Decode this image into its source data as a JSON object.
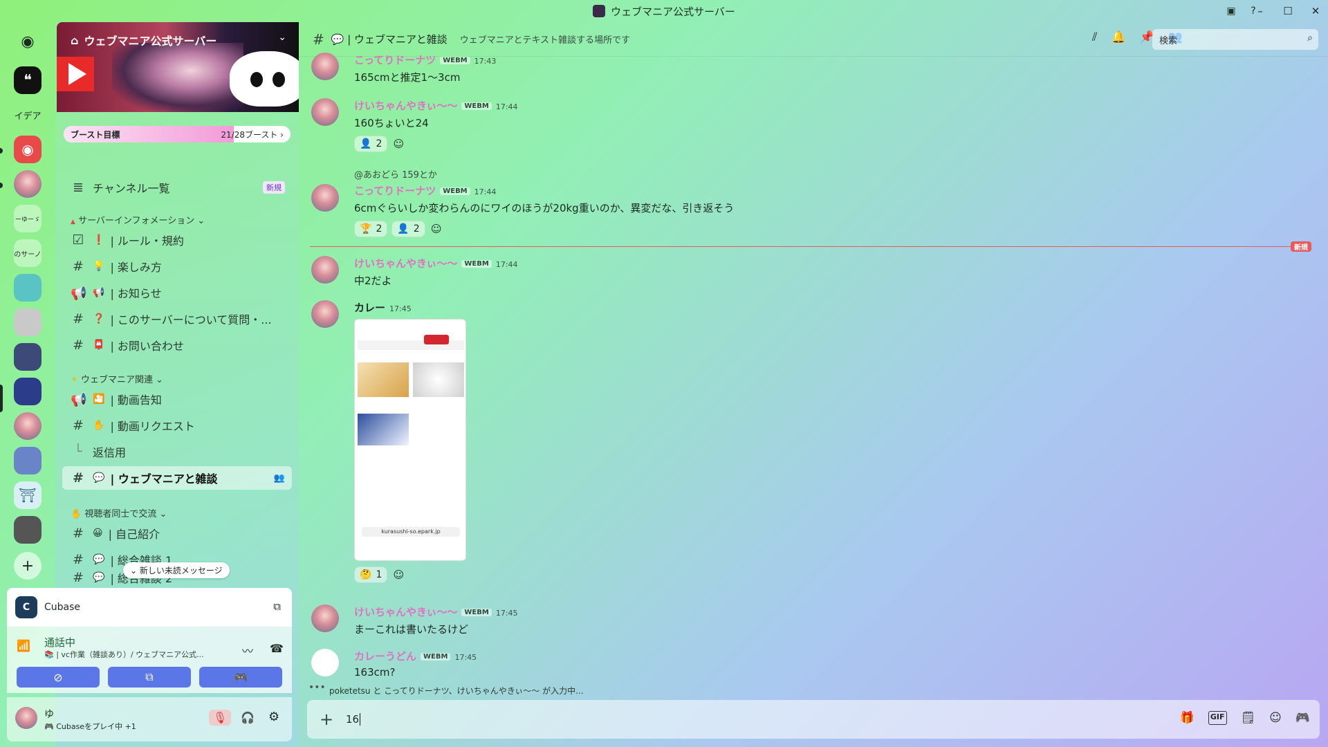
{
  "window": {
    "title": "ウェブマニア公式サーバー",
    "minimize": "–",
    "maximize": "☐",
    "close": "✕",
    "inbox_icon": "▣",
    "help_icon": "?"
  },
  "rail": {
    "labels": {
      "idea": "イデア",
      "other1": "ーゆーゞ",
      "other2": "のサーノ"
    },
    "add": "+"
  },
  "server": {
    "name": "ウェブマニア公式サーバー",
    "chevron": "⌄",
    "boost": {
      "label": "ブースト目標",
      "count": "21/28ブースト ›",
      "progress": 0.75
    },
    "channel_list": "チャンネル一覧",
    "new_badge": "新規",
    "categories": [
      {
        "name": "サーバーインフォメーション ⌄",
        "emoji": "▲"
      },
      {
        "name": "ウェブマニア関連 ⌄",
        "emoji": "✦"
      },
      {
        "name": "視聴者同士で交流 ⌄",
        "emoji": "✋"
      }
    ],
    "channels": [
      {
        "icon": "☑",
        "emoji": "❗",
        "name": "| ルール・規約"
      },
      {
        "icon": "#",
        "emoji": "💡",
        "name": "| 楽しみ方"
      },
      {
        "icon": "📢",
        "emoji": "📢",
        "name": "| お知らせ"
      },
      {
        "icon": "#",
        "emoji": "❓",
        "name": "| このサーバーについて質問・..."
      },
      {
        "icon": "#",
        "emoji": "📮",
        "name": "| お問い合わせ"
      },
      {
        "icon": "📢",
        "emoji": "🎦",
        "name": "| 動画告知"
      },
      {
        "icon": "#",
        "emoji": "✋",
        "name": "| 動画リクエスト"
      },
      {
        "icon": "└",
        "emoji": "",
        "name": "返信用"
      },
      {
        "icon": "#",
        "emoji": "💬",
        "name": "| ウェブマニアと雑談"
      },
      {
        "icon": "#",
        "emoji": "😀",
        "name": "| 自己紹介"
      },
      {
        "icon": "#",
        "emoji": "💬",
        "name": "| 総合雑談 1"
      },
      {
        "icon": "#",
        "emoji": "💬",
        "name": "| 総合雑談 2"
      }
    ],
    "unread_pill": "⌄ 新しい未読メッセージ"
  },
  "activity": {
    "app": "Cubase",
    "icon_letter": "C"
  },
  "voice": {
    "status": "通話中",
    "channel": "📚 | vc作業（雑談あり）/ ウェブマニア公式..."
  },
  "me": {
    "name": "ゆ",
    "status": "🎮 Cubaseをプレイ中 +1"
  },
  "header": {
    "channel": "💬 | ウェブマニアと雑談",
    "topic": "ウェブマニアとテキスト雑談する場所です",
    "search_placeholder": "検索"
  },
  "messages": [
    {
      "user": "こってりドーナツ",
      "tag": "WEBM",
      "time": "17:43",
      "text": "165cmと推定1〜3cm"
    },
    {
      "user": "けいちゃんやきぃ〜〜",
      "tag": "WEBM",
      "time": "17:44",
      "text": "160ちょいと24",
      "reactions": [
        {
          "emoji": "👤",
          "count": "2"
        }
      ]
    },
    {
      "reply": "@あおどら 159とか",
      "user": "こってりドーナツ",
      "tag": "WEBM",
      "time": "17:44",
      "text": "6cmぐらいしか変わらんのにワイのほうが20kg重いのか、異変だな、引き返そう",
      "reactions": [
        {
          "emoji": "🏆",
          "count": "2"
        },
        {
          "emoji": "👤",
          "count": "2"
        }
      ]
    },
    {
      "user": "けいちゃんやきぃ〜〜",
      "tag": "WEBM",
      "time": "17:44",
      "text": "中2だよ"
    },
    {
      "user": "カレー",
      "time": "17:45",
      "image_url": "kurasushi-so.epark.jp",
      "reactions": [
        {
          "emoji": "🤔",
          "count": "1"
        }
      ]
    },
    {
      "user": "けいちゃんやきぃ〜〜",
      "tag": "WEBM",
      "time": "17:45",
      "text": "まーこれは書いたるけど"
    },
    {
      "user": "カレーうどん",
      "tag": "WEBM",
      "time": "17:45",
      "text": "163cm?"
    }
  ],
  "new_divider": "新規",
  "typing": {
    "text": "poketetsu と こってりドーナツ、けいちゃんやきぃ〜〜 が入力中..."
  },
  "composer": {
    "value": "16"
  },
  "colors": {
    "accent": "#5b76e6",
    "username_pink": "#e071c2",
    "divider_red": "#e85a5a"
  }
}
